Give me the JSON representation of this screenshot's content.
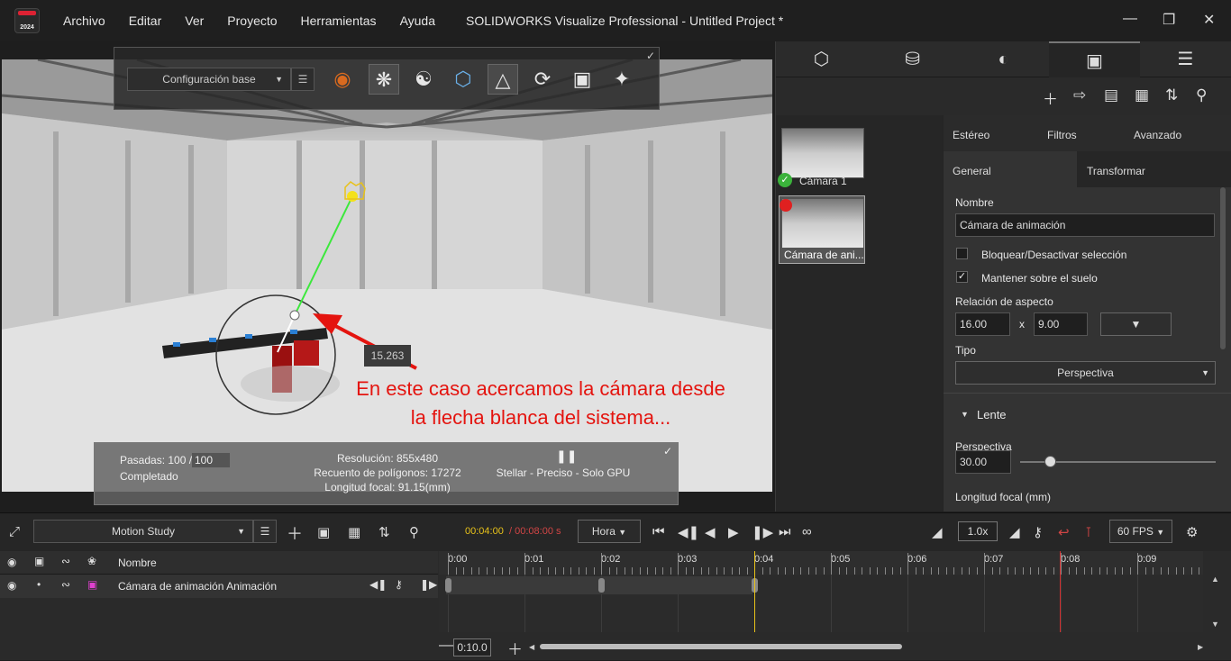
{
  "titlebar": {
    "logo_year": "2024",
    "menus": [
      "Archivo",
      "Editar",
      "Ver",
      "Proyecto",
      "Herramientas",
      "Ayuda"
    ],
    "title": "SOLIDWORKS Visualize Professional - Untitled Project *"
  },
  "viewport": {
    "config_label": "Configuración base",
    "distance_label": "15.263",
    "annotation_line1": "En este caso acercamos la cámara desde",
    "annotation_line2": "la flecha blanca del sistema...",
    "stats": {
      "passes_label": "Pasadas: 100 /",
      "passes_value": "100",
      "status": "Completado",
      "resolution": "Resolución: 855x480",
      "polygons": "Recuento de polígonos: 17272",
      "focal": "Longitud focal: 91.15(mm)",
      "render_mode": "Stellar - Preciso - Solo GPU"
    }
  },
  "right_panel": {
    "cameras": [
      {
        "name": "Cámara 1"
      },
      {
        "name": "Cámara de ani..."
      }
    ],
    "top_tabs": [
      "Estéreo",
      "Filtros",
      "Avanzado"
    ],
    "sub_tabs": [
      "General",
      "Transformar"
    ],
    "name_label": "Nombre",
    "name_value": "Cámara de animación",
    "lock_label": "Bloquear/Desactivar selección",
    "keep_ground_label": "Mantener sobre el suelo",
    "aspect_label": "Relación de aspecto",
    "aspect_w": "16.00",
    "aspect_x": "x",
    "aspect_h": "9.00",
    "type_label": "Tipo",
    "type_value": "Perspectiva",
    "lens_label": "Lente",
    "perspective_label": "Perspectiva",
    "perspective_value": "30.00",
    "perspective_slider_fraction": 0.15,
    "focal_label": "Longitud focal (mm)"
  },
  "timeline": {
    "study_label": "Motion Study",
    "current_time": "00:04:00",
    "total_time": "/ 00:08:00 s",
    "time_unit": "Hora",
    "speed": "1.0x",
    "fps": "60 FPS",
    "header_name": "Nombre",
    "track_name": "Cámara de animación Animación",
    "ticks": [
      "0:00",
      "0:01",
      "0:02",
      "0:03",
      "0:04",
      "0:05",
      "0:06",
      "0:07",
      "0:08",
      "0:09"
    ],
    "zoom": "0:10.0"
  }
}
